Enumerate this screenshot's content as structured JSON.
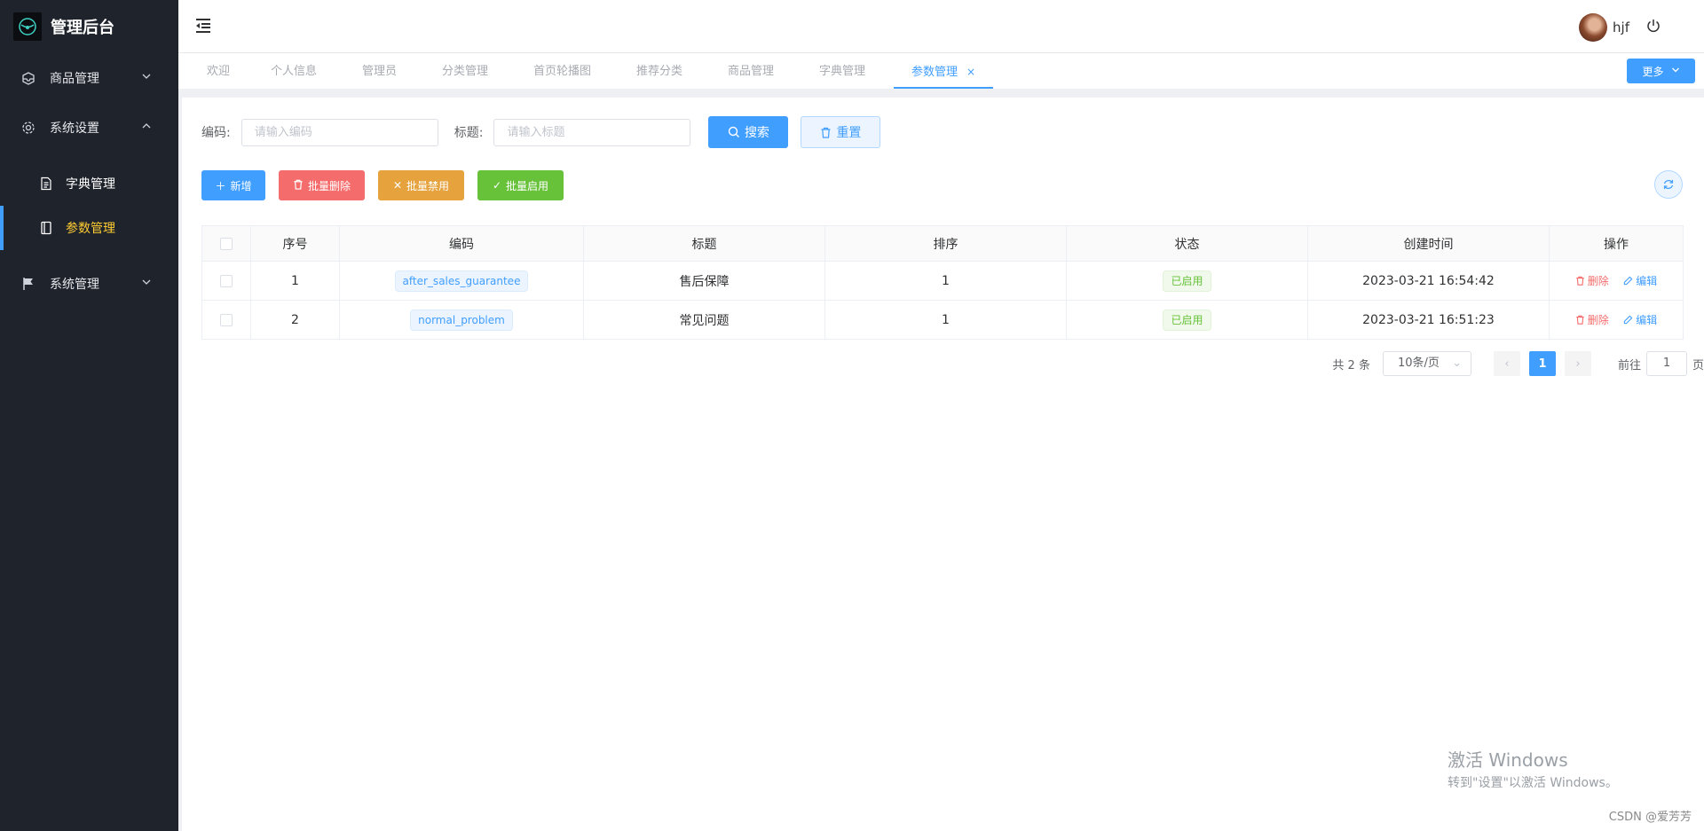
{
  "app": {
    "title": "管理后台"
  },
  "sidebar": {
    "items": [
      {
        "label": "商品管理",
        "icon": "box-icon",
        "expanded": false
      },
      {
        "label": "系统设置",
        "icon": "gear-icon",
        "expanded": true
      },
      {
        "label": "系统管理",
        "icon": "flag-icon",
        "expanded": false
      }
    ],
    "subitems": [
      {
        "label": "字典管理",
        "icon": "document-icon",
        "active": false
      },
      {
        "label": "参数管理",
        "icon": "notebook-icon",
        "active": true
      }
    ]
  },
  "header": {
    "username": "hjf"
  },
  "tabs": {
    "items": [
      "欢迎",
      "个人信息",
      "管理员",
      "分类管理",
      "首页轮播图",
      "推荐分类",
      "商品管理",
      "字典管理",
      "参数管理"
    ],
    "active_index": 8,
    "more_label": "更多"
  },
  "search": {
    "code_label": "编码:",
    "code_placeholder": "请输入编码",
    "title_label": "标题:",
    "title_placeholder": "请输入标题",
    "search_button": "搜索",
    "reset_button": "重置"
  },
  "actions": {
    "add": "新增",
    "batch_delete": "批量删除",
    "batch_disable": "批量禁用",
    "batch_enable": "批量启用"
  },
  "table": {
    "columns": [
      "序号",
      "编码",
      "标题",
      "排序",
      "状态",
      "创建时间",
      "操作"
    ],
    "rows": [
      {
        "index": "1",
        "code": "after_sales_guarantee",
        "title": "售后保障",
        "sort": "1",
        "status": "已启用",
        "created": "2023-03-21 16:54:42",
        "delete": "删除",
        "edit": "编辑"
      },
      {
        "index": "2",
        "code": "normal_problem",
        "title": "常见问题",
        "sort": "1",
        "status": "已启用",
        "created": "2023-03-21 16:51:23",
        "delete": "删除",
        "edit": "编辑"
      }
    ]
  },
  "pagination": {
    "total": "共 2 条",
    "page_size": "10条/页",
    "current": "1",
    "goto_prefix": "前往",
    "goto_value": "1",
    "goto_suffix": "页"
  },
  "watermark": {
    "line1": "激活 Windows",
    "line2": "转到\"设置\"以激活 Windows。",
    "csdn": "CSDN @爱芳芳"
  },
  "colors": {
    "primary": "#409eff",
    "danger": "#f56c6c",
    "warning": "#e6a23c",
    "success": "#67c23a",
    "sidebar_bg": "#1f232b",
    "active_menu": "#ffcc33"
  }
}
